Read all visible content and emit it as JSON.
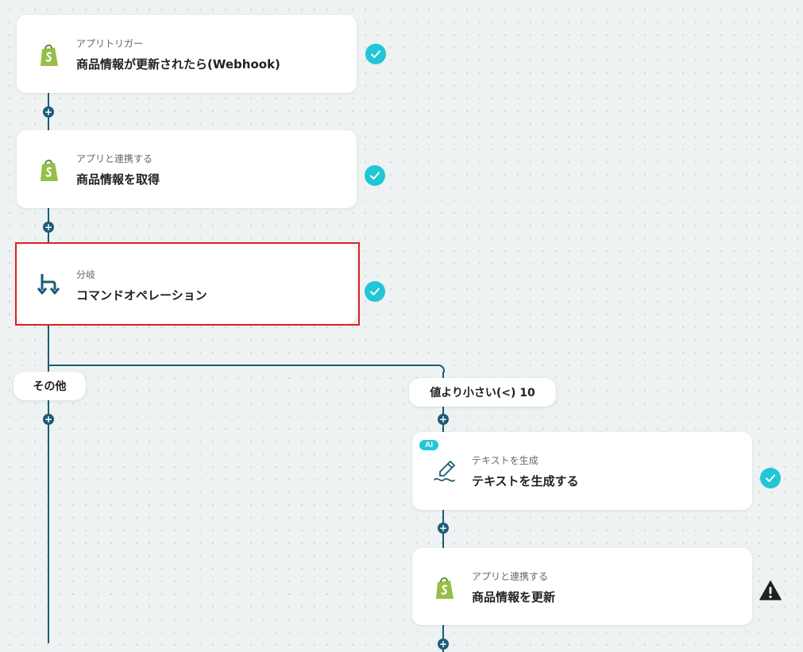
{
  "steps": [
    {
      "subtitle": "アプリトリガー",
      "title": "商品情報が更新されたら(Webhook)",
      "icon": "shopify-icon",
      "status": "success"
    },
    {
      "subtitle": "アプリと連携する",
      "title": "商品情報を取得",
      "icon": "shopify-icon",
      "status": "success"
    },
    {
      "subtitle": "分岐",
      "title": "コマンドオペレーション",
      "icon": "branch-icon",
      "status": "success"
    },
    {
      "subtitle": "テキストを生成",
      "title": "テキストを生成する",
      "icon": "ai-pen-icon",
      "status": "success",
      "badge": "AI"
    },
    {
      "subtitle": "アプリと連携する",
      "title": "商品情報を更新",
      "icon": "shopify-icon",
      "status": "warning"
    }
  ],
  "branches": {
    "other_label": "その他",
    "condition_label": "値より小さい(<) 10"
  },
  "colors": {
    "connector": "#1a5d75",
    "success": "#21c6d7",
    "selected_border": "#e02020",
    "shopify_green": "#95bf47",
    "background": "#eef2f2"
  }
}
